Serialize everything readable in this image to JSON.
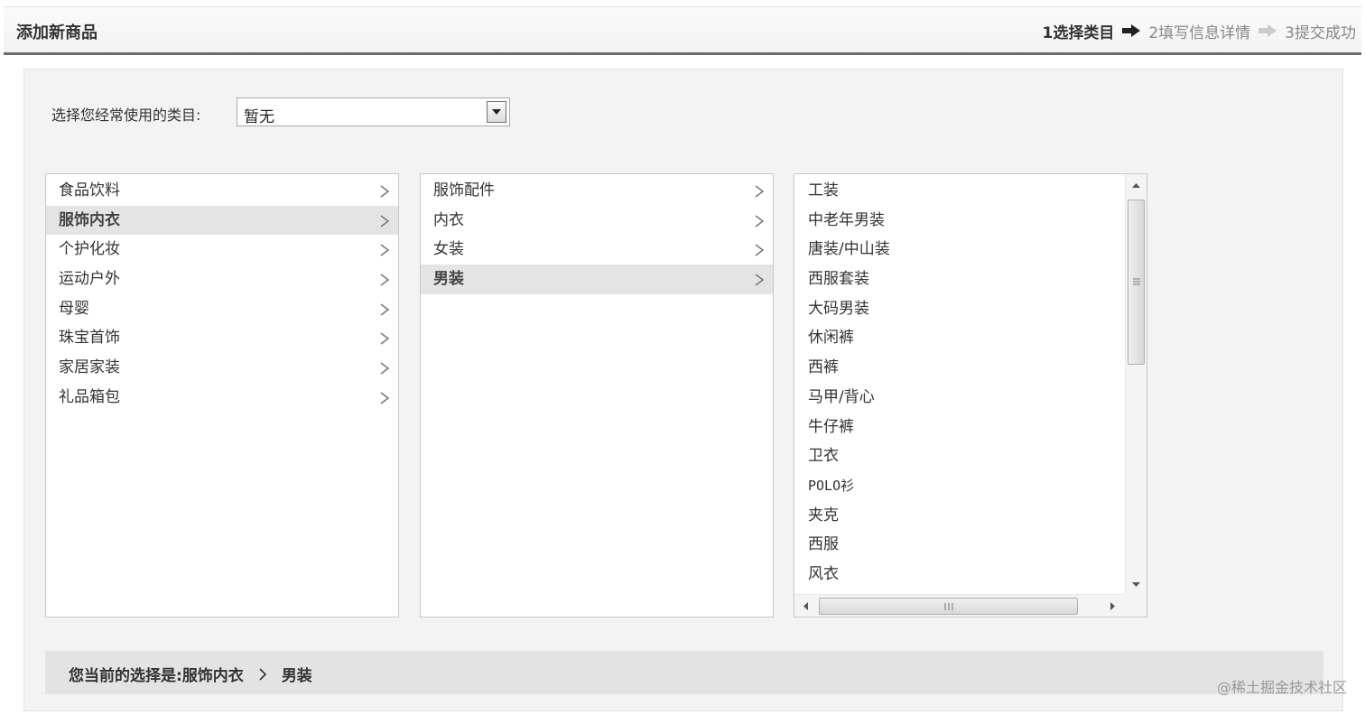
{
  "header": {
    "title": "添加新商品",
    "steps": [
      {
        "label": "1选择类目"
      },
      {
        "label": "2填写信息详情"
      },
      {
        "label": "3提交成功"
      }
    ]
  },
  "common_category": {
    "label": "选择您经常使用的类目:",
    "selected": "暂无"
  },
  "level1": {
    "items": [
      "食品饮料",
      "服饰内衣",
      "个护化妆",
      "运动户外",
      "母婴",
      "珠宝首饰",
      "家居家装",
      "礼品箱包"
    ],
    "selected": "服饰内衣"
  },
  "level2": {
    "items": [
      "服饰配件",
      "内衣",
      "女装",
      "男装"
    ],
    "selected": "男装"
  },
  "level3": {
    "items": [
      "工装",
      "中老年男装",
      "唐装/中山装",
      "西服套装",
      "大码男装",
      "休闲裤",
      "西裤",
      "马甲/背心",
      "牛仔裤",
      "卫衣",
      "POLO衫",
      "夹克",
      "西服",
      "风衣"
    ]
  },
  "current_selection": {
    "label": "您当前的选择是:",
    "path": [
      "服饰内衣",
      "男装"
    ]
  },
  "watermark": "@稀土掘金技术社区",
  "colors": {
    "selected_bg": "#e4e4e4",
    "panel_bg": "#f3f3f3",
    "header_border": "#6b6b6b"
  }
}
